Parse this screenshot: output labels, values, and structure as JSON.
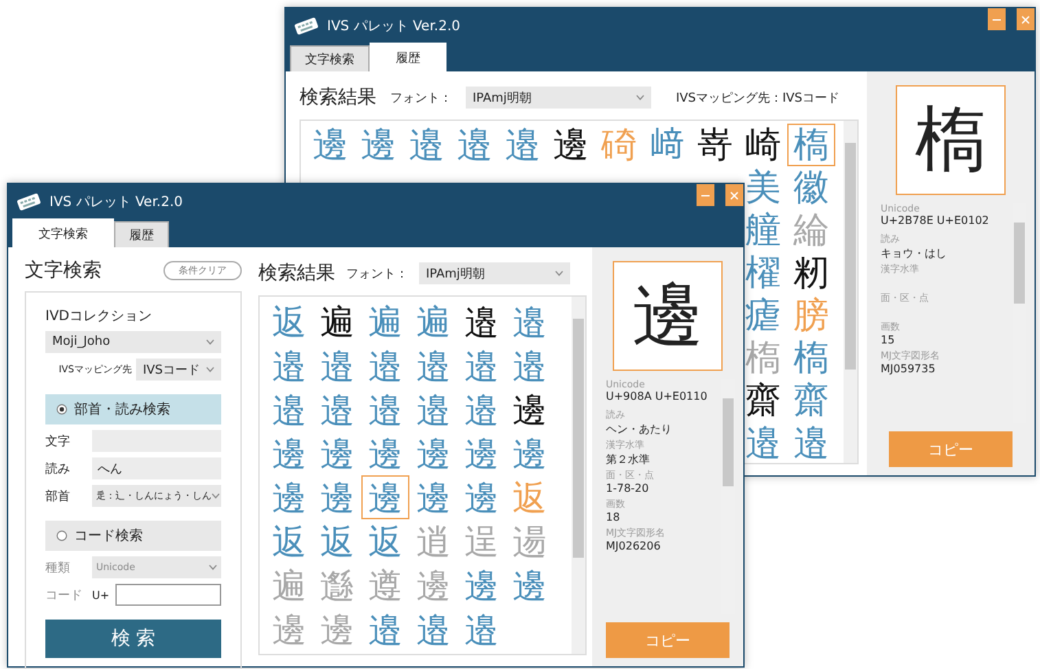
{
  "history_window": {
    "title": "IVS パレット Ver.2.0",
    "tabs": [
      {
        "label": "文字検索",
        "selected": false
      },
      {
        "label": "履歴",
        "selected": true
      }
    ],
    "results_title": "検索結果",
    "font_label": "フォント：",
    "font_value": "IPAmj明朝",
    "mapping": "IVSマッピング先：IVSコード",
    "rows": [
      [
        {
          "char": "邊",
          "color": "#4a8fba",
          "selected": false
        },
        {
          "char": "邊",
          "color": "#4a8fba",
          "selected": false
        },
        {
          "char": "邉",
          "color": "#4a8fba",
          "selected": false
        },
        {
          "char": "邉",
          "color": "#4a8fba",
          "selected": false
        },
        {
          "char": "邉",
          "color": "#4a8fba",
          "selected": false
        },
        {
          "char": "邊",
          "color": "#111111",
          "selected": false
        },
        {
          "char": "碕",
          "color": "#f0a050",
          "selected": false
        },
        {
          "char": "﨑",
          "color": "#4a8fba",
          "selected": false
        },
        {
          "char": "嵜",
          "color": "#111111",
          "selected": false
        },
        {
          "char": "崎",
          "color": "#111111",
          "selected": false
        },
        {
          "char": "槗",
          "color": "#4a8fba",
          "selected": true
        }
      ],
      [
        {
          "char": "美",
          "color": "#4a8fba",
          "selected": false
        },
        {
          "char": "徽",
          "color": "#4a8fba",
          "selected": false
        }
      ],
      [
        {
          "char": "艟",
          "color": "#4a8fba",
          "selected": false
        },
        {
          "char": "綸",
          "color": "#a8a8a8",
          "selected": false
        }
      ],
      [
        {
          "char": "櫂",
          "color": "#4a8fba",
          "selected": false
        },
        {
          "char": "籾",
          "color": "#111111",
          "selected": false
        }
      ],
      [
        {
          "char": "瘧",
          "color": "#4a8fba",
          "selected": false
        },
        {
          "char": "膀",
          "color": "#f0a050",
          "selected": false
        }
      ],
      [
        {
          "char": "槗",
          "color": "#a8a8a8",
          "selected": false
        },
        {
          "char": "槗",
          "color": "#4a8fba",
          "selected": false
        }
      ],
      [
        {
          "char": "齋",
          "color": "#111111",
          "selected": false
        },
        {
          "char": "齋",
          "color": "#4a8fba",
          "selected": false
        }
      ],
      [
        {
          "char": "邉",
          "color": "#4a8fba",
          "selected": false
        },
        {
          "char": "邉",
          "color": "#4a8fba",
          "selected": false
        }
      ]
    ],
    "detail": {
      "preview": "槗",
      "fields": [
        {
          "label": "Unicode",
          "value": "U+2B78E U+E0102"
        },
        {
          "label": "読み",
          "value": "キョウ・はし"
        },
        {
          "label": "漢字水準"
        },
        {
          "label": "面・区・点"
        },
        {
          "label": "画数",
          "value": "15"
        },
        {
          "label": "MJ文字図形名",
          "value": "MJ059735"
        }
      ]
    },
    "copy_button": "コピー"
  },
  "search_window": {
    "title": "IVS パレット Ver.2.0",
    "tabs": [
      {
        "label": "文字検索",
        "selected": true
      },
      {
        "label": "履歴",
        "selected": false
      }
    ],
    "search_title": "文字検索",
    "clear_button": "条件クリア",
    "collection_label": "IVDコレクション",
    "collection_value": "Moji_Joho",
    "mapping_label": "IVSマッピング先",
    "mapping_value": "IVSコード",
    "modes": [
      {
        "label": "部首・読み検索",
        "selected": true,
        "fields": [
          {
            "kind": "text",
            "label": "文字"
          },
          {
            "kind": "text",
            "label": "読み",
            "value": "へん"
          },
          {
            "kind": "select",
            "label": "部首",
            "value": "辵：辶・しんにょう・しん"
          }
        ]
      },
      {
        "label": "コード検索",
        "selected": false,
        "fields": [
          {
            "kind": "select",
            "label": "種類",
            "value": "Unicode"
          },
          {
            "kind": "code",
            "label": "コード",
            "prefix": "U+"
          }
        ]
      }
    ],
    "search_button": "検 索",
    "results_title": "検索結果",
    "font_label": "フォント：",
    "font_value": "IPAmj明朝",
    "rows": [
      [
        {
          "char": "返",
          "color": "#4a8fba",
          "selected": false
        },
        {
          "char": "遍",
          "color": "#111111",
          "selected": false
        },
        {
          "char": "遍",
          "color": "#4a8fba",
          "selected": false
        },
        {
          "char": "遍",
          "color": "#4a8fba",
          "selected": false
        },
        {
          "char": "邉",
          "color": "#111111",
          "selected": false
        },
        {
          "char": "邉",
          "color": "#4a8fba",
          "selected": false
        }
      ],
      [
        {
          "char": "邉",
          "color": "#4a8fba",
          "selected": false
        },
        {
          "char": "邉",
          "color": "#4a8fba",
          "selected": false
        },
        {
          "char": "邉",
          "color": "#4a8fba",
          "selected": false
        },
        {
          "char": "邉",
          "color": "#4a8fba",
          "selected": false
        },
        {
          "char": "邉",
          "color": "#4a8fba",
          "selected": false
        },
        {
          "char": "邉",
          "color": "#4a8fba",
          "selected": false
        }
      ],
      [
        {
          "char": "邉",
          "color": "#4a8fba",
          "selected": false
        },
        {
          "char": "邉",
          "color": "#4a8fba",
          "selected": false
        },
        {
          "char": "邉",
          "color": "#4a8fba",
          "selected": false
        },
        {
          "char": "邉",
          "color": "#4a8fba",
          "selected": false
        },
        {
          "char": "邉",
          "color": "#4a8fba",
          "selected": false
        },
        {
          "char": "邊",
          "color": "#111111",
          "selected": false
        }
      ],
      [
        {
          "char": "邊",
          "color": "#4a8fba",
          "selected": false
        },
        {
          "char": "邊",
          "color": "#4a8fba",
          "selected": false
        },
        {
          "char": "邊",
          "color": "#4a8fba",
          "selected": false
        },
        {
          "char": "邊",
          "color": "#4a8fba",
          "selected": false
        },
        {
          "char": "邊",
          "color": "#4a8fba",
          "selected": false
        },
        {
          "char": "邊",
          "color": "#4a8fba",
          "selected": false
        }
      ],
      [
        {
          "char": "邊",
          "color": "#4a8fba",
          "selected": false
        },
        {
          "char": "邊",
          "color": "#4a8fba",
          "selected": false
        },
        {
          "char": "邊",
          "color": "#4a8fba",
          "selected": true
        },
        {
          "char": "邊",
          "color": "#4a8fba",
          "selected": false
        },
        {
          "char": "邊",
          "color": "#4a8fba",
          "selected": false
        },
        {
          "char": "返",
          "color": "#f0a050",
          "selected": false
        }
      ],
      [
        {
          "char": "返",
          "color": "#4a8fba",
          "selected": false
        },
        {
          "char": "返",
          "color": "#4a8fba",
          "selected": false
        },
        {
          "char": "返",
          "color": "#4a8fba",
          "selected": false
        },
        {
          "char": "逍",
          "color": "#a8a8a8",
          "selected": false
        },
        {
          "char": "逞",
          "color": "#a8a8a8",
          "selected": false
        },
        {
          "char": "逿",
          "color": "#a8a8a8",
          "selected": false
        }
      ],
      [
        {
          "char": "遍",
          "color": "#a8a8a8",
          "selected": false
        },
        {
          "char": "邎",
          "color": "#a8a8a8",
          "selected": false
        },
        {
          "char": "遵",
          "color": "#a8a8a8",
          "selected": false
        },
        {
          "char": "邊",
          "color": "#a8a8a8",
          "selected": false
        },
        {
          "char": "邊",
          "color": "#4a8fba",
          "selected": false
        },
        {
          "char": "邊",
          "color": "#4a8fba",
          "selected": false
        }
      ],
      [
        {
          "char": "邊",
          "color": "#a8a8a8",
          "selected": false
        },
        {
          "char": "邊",
          "color": "#a8a8a8",
          "selected": false
        },
        {
          "char": "邉",
          "color": "#4a8fba",
          "selected": false
        },
        {
          "char": "邉",
          "color": "#4a8fba",
          "selected": false
        },
        {
          "char": "邉",
          "color": "#4a8fba",
          "selected": false
        }
      ]
    ],
    "detail": {
      "preview": "邊",
      "fields": [
        {
          "label": "Unicode",
          "value": "U+908A U+E0110"
        },
        {
          "label": "読み",
          "value": "ヘン・あたり"
        },
        {
          "label": "漢字水準",
          "value": "第２水準"
        },
        {
          "label": "面・区・点",
          "value": "1-78-20"
        },
        {
          "label": "画数",
          "value": "18"
        },
        {
          "label": "MJ文字図形名",
          "value": "MJ026206"
        }
      ]
    },
    "copy_button": "コピー"
  }
}
